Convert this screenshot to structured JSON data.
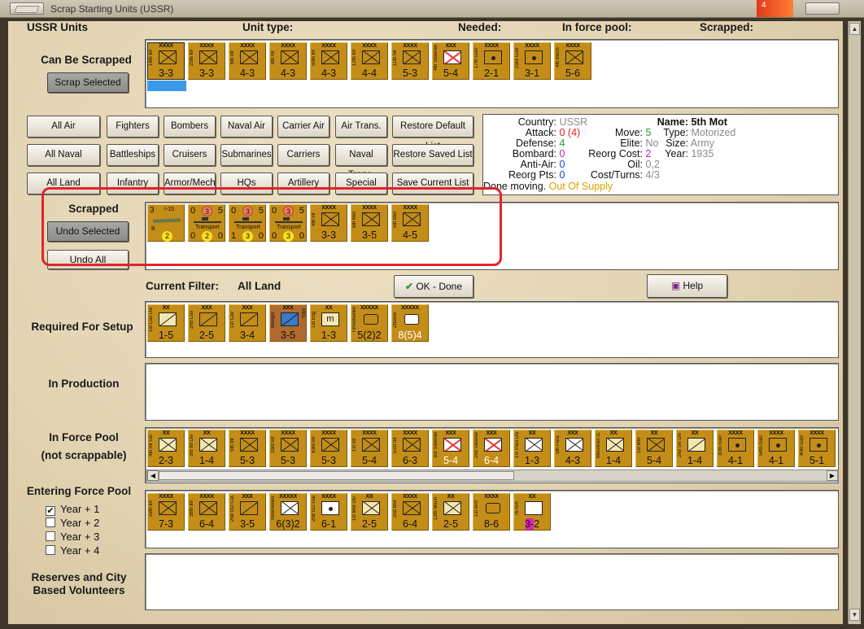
{
  "window": {
    "title": "Scrap Starting Units (USSR)",
    "flame": "4"
  },
  "headers": {
    "ussr_units": "USSR Units",
    "unit_type": "Unit type:",
    "needed": "Needed:",
    "in_force_pool": "In force pool:",
    "scrapped": "Scrapped:"
  },
  "can_be_scrapped": {
    "label": "Can Be Scrapped",
    "button": "Scrap Selected",
    "units": [
      {
        "size": "XXXX",
        "name": "14th Inf",
        "str": "3-3",
        "t": "inf"
      },
      {
        "size": "XXXX",
        "name": "25th Inf",
        "str": "3-3",
        "t": "inf"
      },
      {
        "size": "XXXX",
        "name": "6th Inf",
        "str": "4-3",
        "t": "inf"
      },
      {
        "size": "XXXX",
        "name": "8th Inf",
        "str": "4-3",
        "t": "inf"
      },
      {
        "size": "XXXX",
        "name": "50th Inf",
        "str": "4-3",
        "t": "inf"
      },
      {
        "size": "XXXX",
        "name": "12th Inf",
        "str": "4-4",
        "t": "inf"
      },
      {
        "size": "XXXX",
        "name": "11th Inf",
        "str": "5-3",
        "t": "inf"
      },
      {
        "size": "XXX",
        "name": "4th Siberian",
        "str": "5-4",
        "t": "red"
      },
      {
        "size": "XXXX",
        "name": "17th Garr",
        "str": "2-1",
        "t": "dot"
      },
      {
        "size": "XXXX",
        "name": "23rd Garr",
        "str": "3-1",
        "t": "dot"
      },
      {
        "size": "XXXX",
        "name": "4th Mech",
        "str": "5-6",
        "t": "inf"
      }
    ]
  },
  "filters": {
    "row1": [
      "All Air",
      "Fighters",
      "Bombers",
      "Naval Air",
      "Carrier Air",
      "Air Trans.",
      "Restore Default List"
    ],
    "row2": [
      "All Naval",
      "Battleships",
      "Cruisers",
      "Submarines",
      "Carriers",
      "Naval Trans.",
      "Restore Saved List"
    ],
    "row3": [
      "All Land",
      "Infantry",
      "Armor/Mech",
      "HQs",
      "Artillery",
      "Special",
      "Save Current List"
    ]
  },
  "info": {
    "country_k": "Country:",
    "country_v": "USSR",
    "attack_k": "Attack:",
    "attack_v": "0 (4)",
    "defense_k": "Defense:",
    "defense_v": "4",
    "bombard_k": "Bombard:",
    "bombard_v": "0",
    "antiair_k": "Anti-Air:",
    "antiair_v": "0",
    "reorgpts_k": "Reorg Pts:",
    "reorgpts_v": "0",
    "move_k": "Move:",
    "move_v": "5",
    "elite_k": "Elite:",
    "elite_v": "No",
    "reorgcost_k": "Reorg Cost:",
    "reorgcost_v": "2",
    "oil_k": "Oil:",
    "oil_v": "0,2",
    "costturns_k": "Cost/Turns:",
    "costturns_v": "4/3",
    "name_k": "Name:",
    "name_v": "5th Mot",
    "type_k": "Type:",
    "type_v": "Motorized",
    "size_k": "Size:",
    "size_v": "Army",
    "year_k": "Year:",
    "year_v": "1935",
    "done_k": "Done moving.",
    "done_v": "Out Of Supply",
    "colors": {
      "attack": "#e02020",
      "defense": "#2a9a2a",
      "bombard": "#c020c0",
      "antiair": "#2040d0",
      "grey": "#8a8a8a",
      "supply": "#e0a000"
    }
  },
  "scrapped": {
    "label": "Scrapped",
    "undo_selected": "Undo Selected",
    "undo_all": "Undo All",
    "units": [
      {
        "kind": "air",
        "tl": "3",
        "type": "I-15",
        "bl": "B",
        "circ": "2"
      },
      {
        "kind": "ship",
        "tl": "0",
        "tc": "3",
        "tr": "5",
        "type": "Transport",
        "bl": "0",
        "circ": "2",
        "br": "0"
      },
      {
        "kind": "ship",
        "tl": "0",
        "tc": "3",
        "tr": "5",
        "type": "Transport",
        "bl": "1",
        "circ": "3",
        "br": "0"
      },
      {
        "kind": "ship",
        "tl": "0",
        "tc": "3",
        "tr": "5",
        "type": "Transport",
        "bl": "0",
        "circ": "3",
        "br": "0"
      },
      {
        "kind": "unit",
        "size": "XXXX",
        "name": "4th Inf",
        "str": "3-3",
        "t": "inf"
      },
      {
        "kind": "unit",
        "size": "XXXX",
        "name": "6th Mot",
        "str": "3-5",
        "t": "inf"
      },
      {
        "kind": "unit",
        "size": "XXXX",
        "name": "5th Mot",
        "str": "4-5",
        "t": "inf"
      }
    ]
  },
  "current_filter": {
    "label": "Current Filter:",
    "value": "All Land"
  },
  "ok_button": "OK - Done",
  "help_button": "Help",
  "required": {
    "label": "Required For Setup",
    "units": [
      {
        "size": "XX",
        "name": "1st Cav Div",
        "str": "1-5",
        "t": "cav light"
      },
      {
        "size": "XXX",
        "name": "2nd Cav",
        "str": "2-5",
        "t": "cav"
      },
      {
        "size": "XXX",
        "name": "1st Cav",
        "str": "3-4",
        "t": "cav"
      },
      {
        "size": "XXX",
        "name": "Mongol",
        "str": "3-5",
        "t": "cav blue",
        "mongol": true,
        "right": "MGL"
      },
      {
        "size": "XX",
        "name": "1st Eng",
        "str": "1-3",
        "t": "light",
        "inner": "m"
      },
      {
        "size": "XXXXX",
        "name": "Timoshenko",
        "str": "5(2)2",
        "t": "hq"
      },
      {
        "size": "XXXXX",
        "name": "Zhukov",
        "str": "8(5)4",
        "t": "hq white",
        "whitestr": true
      }
    ]
  },
  "in_production": {
    "label": "In Production"
  },
  "in_force_pool": {
    "label": "In Force Pool",
    "sub": "(not scrappable)",
    "units": [
      {
        "size": "XX",
        "name": "4th Inf Div",
        "str": "2-3",
        "t": "inf light"
      },
      {
        "size": "XX",
        "name": "3rd Inf Div",
        "str": "1-4",
        "t": "inf light"
      },
      {
        "size": "XXXX",
        "name": "5th Inf",
        "str": "5-3",
        "t": "inf"
      },
      {
        "size": "XXXX",
        "name": "33rd Inf",
        "str": "5-3",
        "t": "inf"
      },
      {
        "size": "XXXX",
        "name": "43rd Inf",
        "str": "5-3",
        "t": "inf"
      },
      {
        "size": "XXXX",
        "name": "1st Inf",
        "str": "5-4",
        "t": "inf"
      },
      {
        "size": "XXXX",
        "name": "51st Inf",
        "str": "6-3",
        "t": "inf"
      },
      {
        "size": "XXX",
        "name": "3rd Siberian",
        "str": "5-4",
        "t": "red",
        "whitestr": true
      },
      {
        "size": "XXX",
        "name": "2nd Siberian",
        "str": "6-4",
        "t": "red",
        "whitestr": true
      },
      {
        "size": "XX",
        "name": "1st Para Div",
        "str": "1-3",
        "t": "inf white"
      },
      {
        "size": "XXX",
        "name": "5th Para",
        "str": "4-3",
        "t": "inf white"
      },
      {
        "size": "XX",
        "name": "Mountain D.",
        "str": "1-4",
        "t": "inf light"
      },
      {
        "size": "XX",
        "name": "1st Mtn",
        "str": "5-4",
        "t": "inf"
      },
      {
        "size": "XX",
        "name": "2nd Ski Div",
        "str": "1-4",
        "t": "cav light"
      },
      {
        "size": "XXXX",
        "name": "30th Garr",
        "str": "4-1",
        "t": "dot"
      },
      {
        "size": "XXXX",
        "name": "54th Garr",
        "str": "4-1",
        "t": "dot"
      },
      {
        "size": "XXXX",
        "name": "40th Garr",
        "str": "5-1",
        "t": "dot"
      }
    ]
  },
  "entering": {
    "label": "Entering Force Pool",
    "years": [
      {
        "label": "Year + 1",
        "checked": "✔"
      },
      {
        "label": "Year + 2",
        "checked": ""
      },
      {
        "label": "Year + 3",
        "checked": ""
      },
      {
        "label": "Year + 4",
        "checked": ""
      }
    ],
    "units": [
      {
        "size": "XXXX",
        "name": "29th Inf",
        "str": "7-3",
        "t": "inf"
      },
      {
        "size": "XXXX",
        "name": "38th Inf",
        "str": "6-4",
        "t": "inf"
      },
      {
        "size": "XXX",
        "name": "2nd GD Cav",
        "str": "3-5",
        "t": "cav"
      },
      {
        "size": "XXXXX",
        "name": "Yeremenko",
        "str": "6(3)2",
        "t": "inf white"
      },
      {
        "size": "XXXX",
        "name": "2nd GD Garr",
        "str": "6-1",
        "t": "dot white"
      },
      {
        "size": "XX",
        "name": "1st Mot Div",
        "str": "2-5",
        "t": "inf light"
      },
      {
        "size": "XXXX",
        "name": "2nd Mot",
        "str": "6-4",
        "t": "inf"
      },
      {
        "size": "XX",
        "name": "13th Mech",
        "str": "2-5",
        "t": "inf light"
      },
      {
        "size": "XXXX",
        "name": "1st Arm",
        "str": "8-6",
        "t": "hq"
      },
      {
        "size": "XX",
        "name": "76 mm",
        "str": "3-2",
        "t": "white",
        "mag": true
      }
    ]
  },
  "reserves": {
    "label": "Reserves and City Based Volunteers"
  }
}
